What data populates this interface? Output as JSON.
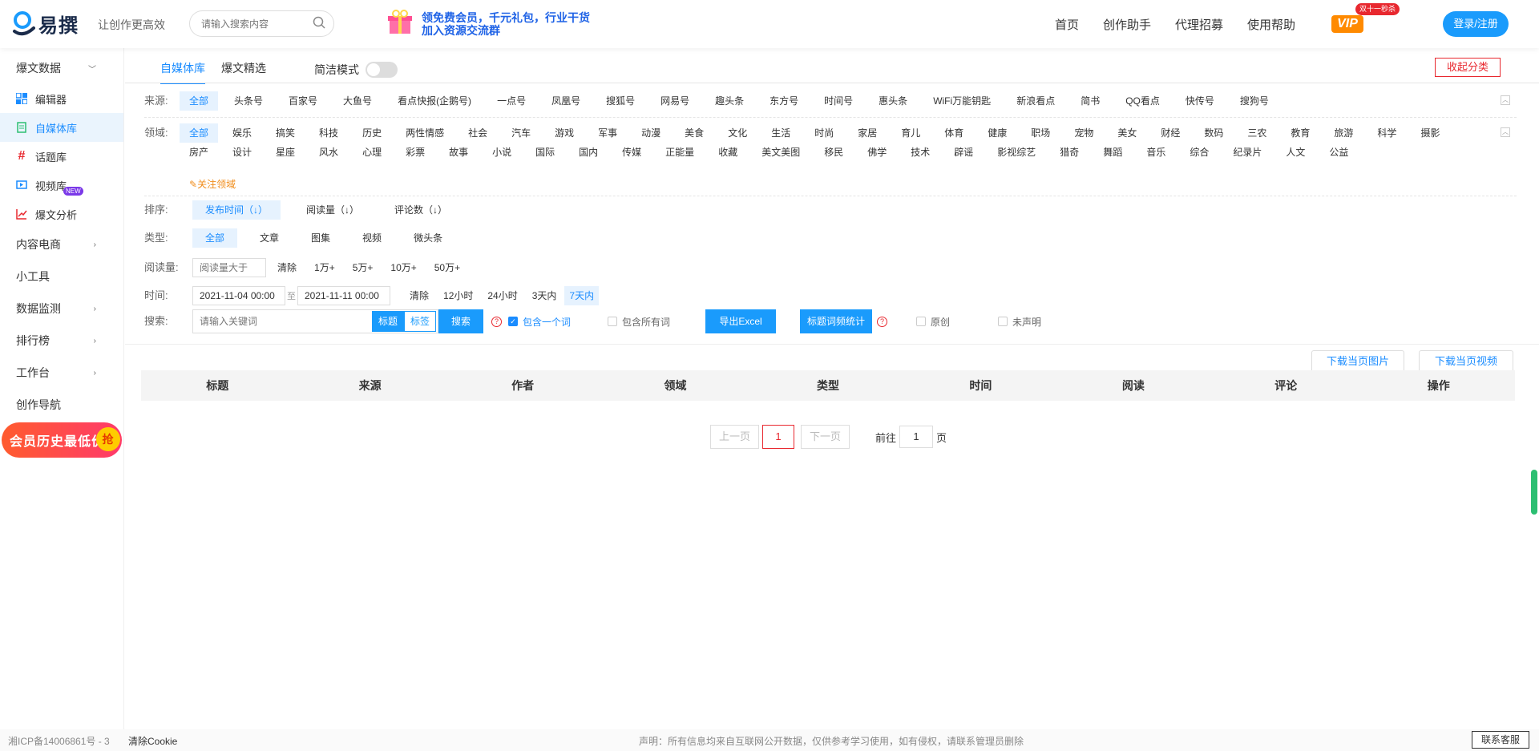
{
  "header": {
    "logo_text": "易撰",
    "slogan": "让创作更高效",
    "search_placeholder": "请输入搜索内容",
    "banner_line1": "领免费会员，千元礼包，行业干货",
    "banner_line2": "加入资源交流群",
    "nav": [
      "首页",
      "创作助手",
      "代理招募",
      "使用帮助"
    ],
    "vip_label": "VIP",
    "vip_badge": "双十一秒杀",
    "login_label": "登录/注册"
  },
  "sidebar": {
    "group_hot": "爆文数据",
    "items": [
      "编辑器",
      "自媒体库",
      "话题库",
      "视频库",
      "爆文分析"
    ],
    "groups": [
      "内容电商",
      "小工具",
      "数据监测",
      "排行榜",
      "工作台",
      "创作导航"
    ],
    "new_tag": "NEW",
    "promo_text": "会员历史最低价",
    "promo_tag": "抢"
  },
  "tabs": [
    "自媒体库",
    "爆文精选"
  ],
  "simple_mode": "简洁模式",
  "collapse_label": "收起分类",
  "filters": {
    "source_label": "来源:",
    "sources": [
      "全部",
      "头条号",
      "百家号",
      "大鱼号",
      "看点快报(企鹅号)",
      "一点号",
      "凤凰号",
      "搜狐号",
      "网易号",
      "趣头条",
      "东方号",
      "时间号",
      "惠头条",
      "WiFi万能钥匙",
      "新浪看点",
      "简书",
      "QQ看点",
      "快传号",
      "搜狗号"
    ],
    "field_label": "领域:",
    "fields": [
      "全部",
      "娱乐",
      "搞笑",
      "科技",
      "历史",
      "两性情感",
      "社会",
      "汽车",
      "游戏",
      "军事",
      "动漫",
      "美食",
      "文化",
      "生活",
      "时尚",
      "家居",
      "育儿",
      "体育",
      "健康",
      "职场",
      "宠物",
      "美女",
      "财经",
      "数码",
      "三农",
      "教育",
      "旅游",
      "科学",
      "摄影",
      "房产",
      "设计",
      "星座",
      "风水",
      "心理",
      "彩票",
      "故事",
      "小说",
      "国际",
      "国内",
      "传媒",
      "正能量",
      "收藏",
      "美文美图",
      "移民",
      "佛学",
      "技术",
      "辟谣",
      "影视综艺",
      "猎奇",
      "舞蹈",
      "音乐",
      "综合",
      "纪录片",
      "人文",
      "公益"
    ],
    "follow_field": "关注领域",
    "sort_label": "排序:",
    "sorts": [
      "发布时间（↓）",
      "阅读量（↓）",
      "评论数（↓）"
    ],
    "type_label": "类型:",
    "types": [
      "全部",
      "文章",
      "图集",
      "视频",
      "微头条"
    ],
    "read_label": "阅读量:",
    "read_placeholder": "阅读量大于",
    "reads": [
      "清除",
      "1万+",
      "5万+",
      "10万+",
      "50万+"
    ],
    "time_label": "时间:",
    "time_start": "2021-11-04 00:00",
    "time_to": "至",
    "time_end": "2021-11-11 00:00",
    "times": [
      "清除",
      "12小时",
      "24小时",
      "3天内",
      "7天内"
    ],
    "search_label": "搜索:",
    "keyword_placeholder": "请输入关键词",
    "mode_title": "标题",
    "mode_tag": "标签",
    "search_btn": "搜索",
    "qmark": "?",
    "contain_one": "包含一个词",
    "contain_all": "包含所有词",
    "export_excel": "导出Excel",
    "title_stats": "标题词频统计",
    "original": "原创",
    "undeclared": "未声明",
    "check": "✓"
  },
  "download": {
    "images": "下载当页图片",
    "videos": "下载当页视频"
  },
  "table_headers": [
    "标题",
    "来源",
    "作者",
    "领域",
    "类型",
    "时间",
    "阅读",
    "评论",
    "操作"
  ],
  "pager": {
    "prev": "上一页",
    "current": "1",
    "next": "下一页",
    "goto": "前往",
    "goto_value": "1",
    "page_unit": "页"
  },
  "footer": {
    "icp": "湘ICP备14006861号 - 3",
    "clear_cookie": "清除Cookie",
    "statement": "声明：所有信息均来自互联网公开数据，仅供参考学习使用，如有侵权，请联系管理员删除",
    "contact": "联系客服"
  },
  "colors": {
    "accent": "#1a8cff",
    "button": "#1a9bfc",
    "danger": "#e8282f",
    "follow": "#f08c1a"
  }
}
